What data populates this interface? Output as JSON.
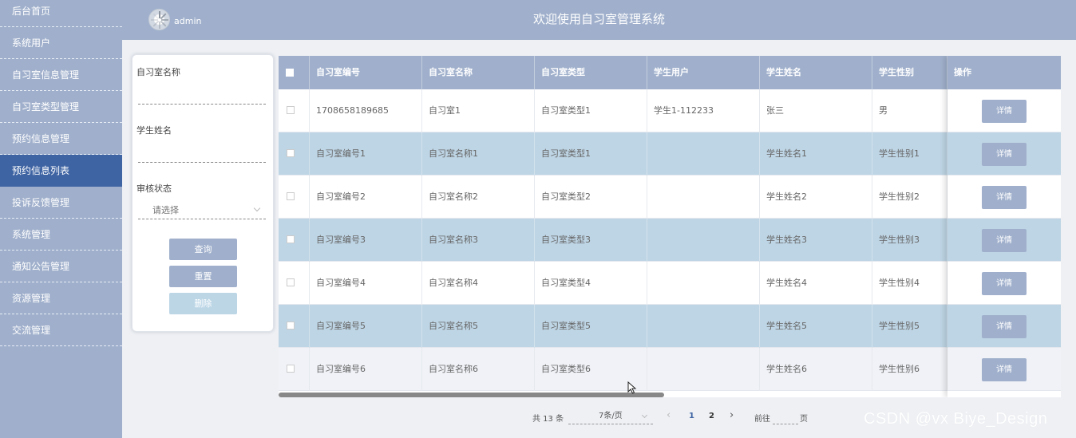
{
  "sidebar": {
    "items": [
      {
        "label": "后台首页"
      },
      {
        "label": "系统用户"
      },
      {
        "label": "自习室信息管理"
      },
      {
        "label": "自习室类型管理"
      },
      {
        "label": "预约信息管理"
      },
      {
        "label": "预约信息列表",
        "active": true
      },
      {
        "label": "投诉反馈管理"
      },
      {
        "label": "系统管理"
      },
      {
        "label": "通知公告管理"
      },
      {
        "label": "资源管理"
      },
      {
        "label": "交流管理"
      }
    ]
  },
  "header": {
    "username": "admin",
    "title": "欢迎使用自习室管理系统"
  },
  "search": {
    "room_name_label": "自习室名称",
    "room_name_value": "",
    "student_name_label": "学生姓名",
    "student_name_value": "",
    "status_label": "审核状态",
    "status_placeholder": "请选择",
    "query_button": "查询",
    "reset_button": "重置",
    "delete_button": "删除"
  },
  "table": {
    "headers": [
      "自习室编号",
      "自习室名称",
      "自习室类型",
      "学生用户",
      "学生姓名",
      "学生性别",
      "操作"
    ],
    "detail_label": "详情",
    "rows": [
      [
        "1708658189685",
        "自习室1",
        "自习室类型1",
        "学生1-112233",
        "张三",
        "男"
      ],
      [
        "自习室编号1",
        "自习室名称1",
        "自习室类型1",
        "",
        "学生姓名1",
        "学生性别1"
      ],
      [
        "自习室编号2",
        "自习室名称2",
        "自习室类型2",
        "",
        "学生姓名2",
        "学生性别2"
      ],
      [
        "自习室编号3",
        "自习室名称3",
        "自习室类型3",
        "",
        "学生姓名3",
        "学生性别3"
      ],
      [
        "自习室编号4",
        "自习室名称4",
        "自习室类型4",
        "",
        "学生姓名4",
        "学生性别4"
      ],
      [
        "自习室编号5",
        "自习室名称5",
        "自习室类型5",
        "",
        "学生姓名5",
        "学生性别5"
      ],
      [
        "自习室编号6",
        "自习室名称6",
        "自习室类型6",
        "",
        "学生姓名6",
        "学生性别6"
      ]
    ]
  },
  "pagination": {
    "total": "共 13 条",
    "page_size": "7条/页",
    "pages": [
      "1",
      "2"
    ],
    "current_page": "1",
    "goto_prefix": "前往",
    "goto_suffix": "页",
    "prev_icon": "‹",
    "next_icon": "›"
  },
  "watermark": "CSDN @vx Biye_Design",
  "colors": {
    "sidebar": "#a0b0cc",
    "sidebar_active": "#3f64a3",
    "row_alt": "#bed5e5",
    "page_active": "#3f64a3"
  }
}
